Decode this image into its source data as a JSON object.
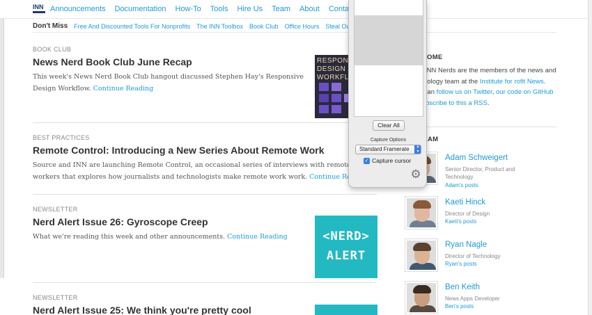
{
  "nav": {
    "logo": "INN",
    "links": [
      "Announcements",
      "Documentation",
      "How-To",
      "Tools",
      "Hire Us",
      "Team",
      "About",
      "Contact"
    ]
  },
  "subnav": {
    "label": "Don't Miss",
    "links": [
      "Free And Discounted Tools For Nonprofits",
      "The INN Toolbox",
      "Book Club",
      "Office Hours",
      "Steal Ou"
    ]
  },
  "articles": [
    {
      "category": "BOOK CLUB",
      "title": "News Nerd Book Club June Recap",
      "excerpt": "This week's News Nerd Book Club hangout discussed Stephen Hay's Responsive Design Workflow.",
      "more": "Continue Reading"
    },
    {
      "category": "BEST PRACTICES",
      "title": "Remote Control: Introducing a New Series About Remote Work",
      "excerpt": "Source and INN are launching Remote Control, an occasional series of interviews with remote workers that explores how journalists and technologists make remote work work.",
      "more": "Continue Reading"
    },
    {
      "category": "NEWSLETTER",
      "title": "Nerd Alert Issue 26: Gyroscope Creep",
      "excerpt": "What we're reading this week and other announcements.",
      "more": "Continue Reading"
    },
    {
      "category": "NEWSLETTER",
      "title": "Nerd Alert Issue 25: We think you're pretty cool"
    }
  ],
  "thumbs": {
    "book_text": "RESPONS DESIGN WORKFLO",
    "nerd_line1": "<NERD>",
    "nerd_line2": "ALERT"
  },
  "sidebar": {
    "welcome_heading": "OME",
    "welcome_parts": {
      "t1": "INN Nerds are the members of the news and technology team at the ",
      "l1": "Institute for",
      "l1b": "rofit News",
      "t2": ". You can ",
      "l2": "follow us on Twitter",
      "t3": ", ",
      "l3": "our code on GitHub",
      "t4": " or ",
      "l4": "subscribe to this",
      "l4b": "a RSS",
      "t5": "."
    },
    "team_heading": "UR TEAM",
    "staff": [
      {
        "name": "Adam Schweigert",
        "title": "Senior Director, Product and Technology",
        "posts": "Adam's posts"
      },
      {
        "name": "Kaeti Hinck",
        "title": "Director of Design",
        "posts": "Kaeti's posts"
      },
      {
        "name": "Ryan Nagle",
        "title": "Director of Technology",
        "posts": "Ryan's posts"
      },
      {
        "name": "Ben Keith",
        "title": "News Apps Developer",
        "posts": "Ben's posts"
      }
    ]
  },
  "capture": {
    "clear_label": "Clear All",
    "options_label": "Capture Options",
    "framerate_value": "Standard Framerate",
    "cursor_label": "Capture cursor",
    "cursor_checked": true,
    "accent": "#3a7ee6"
  }
}
